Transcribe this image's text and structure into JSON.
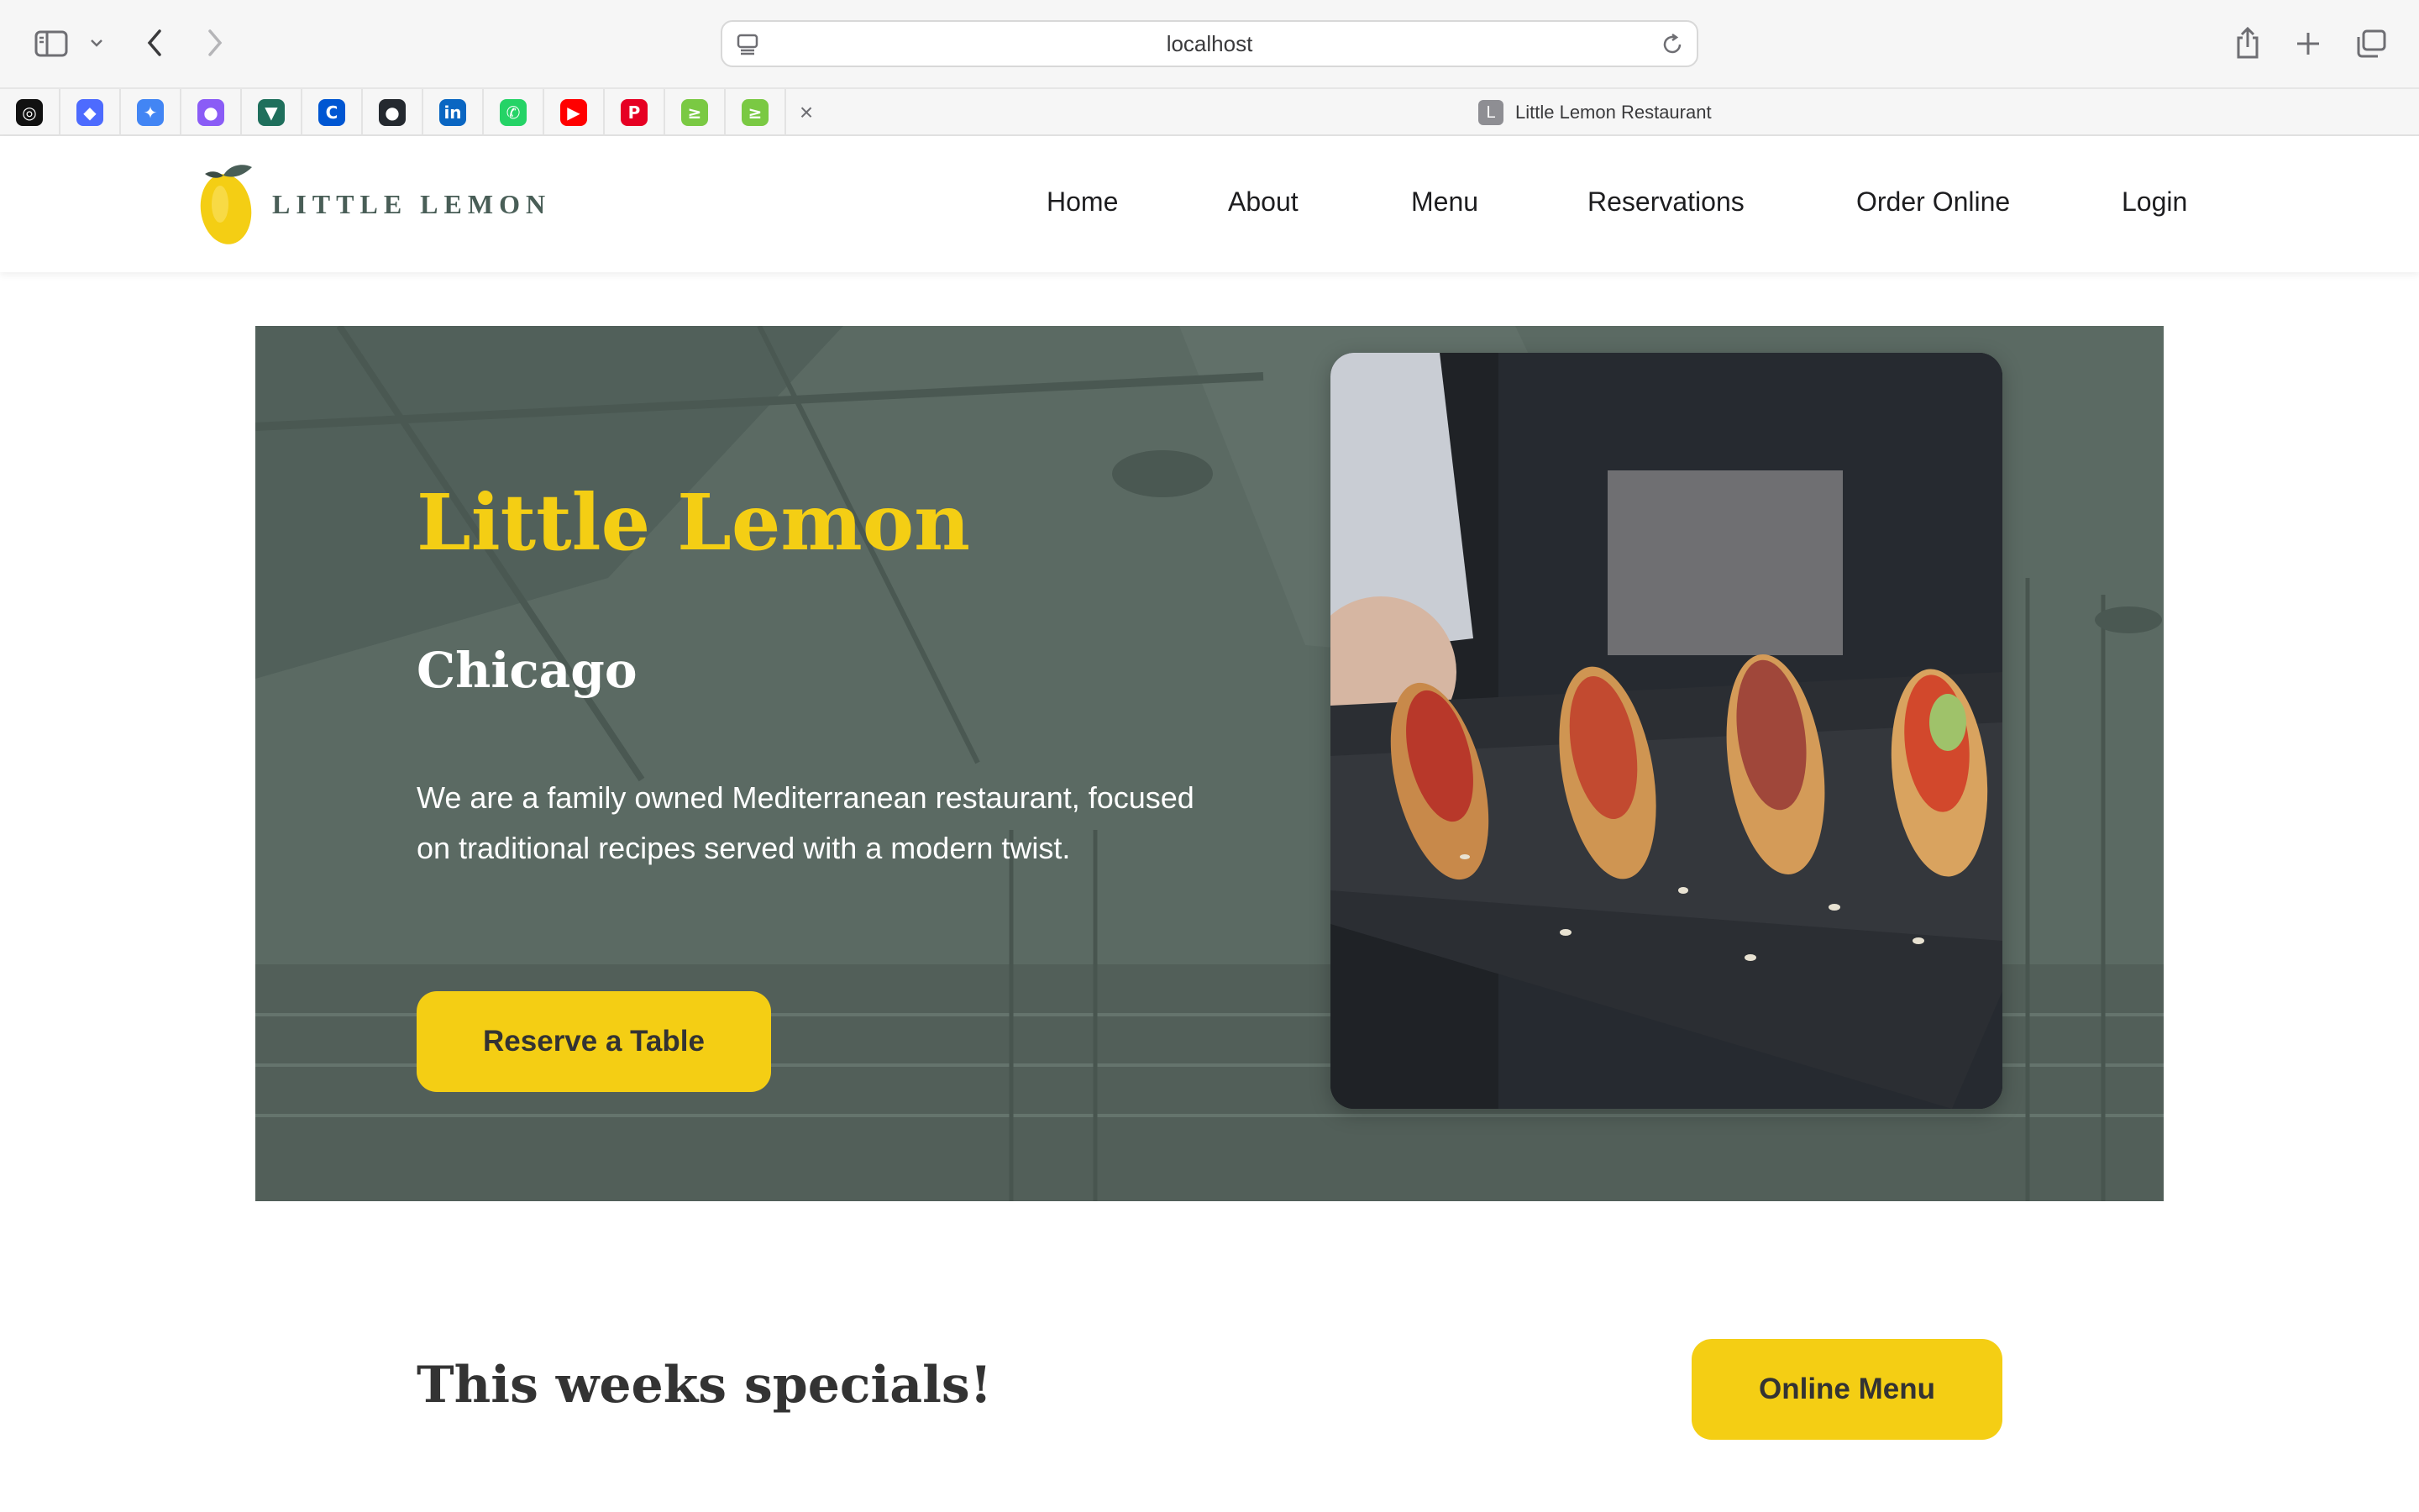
{
  "browser": {
    "url": "localhost",
    "active_tab_title": "Little Lemon Restaurant",
    "active_tab_favicon_letter": "L",
    "pinned_tabs": [
      {
        "icon": "openai-icon",
        "color": "#111111",
        "glyph": "◎"
      },
      {
        "icon": "deepseek-icon",
        "color": "#4d6bfe",
        "glyph": "◆"
      },
      {
        "icon": "gemini-icon",
        "color": "#4285f4",
        "glyph": "✦"
      },
      {
        "icon": "copilot-icon",
        "color": "#8a5cf6",
        "glyph": "●"
      },
      {
        "icon": "vue-icon",
        "color": "#1f6f5c",
        "glyph": "▼"
      },
      {
        "icon": "coursera-icon",
        "color": "#0056d2",
        "glyph": "C"
      },
      {
        "icon": "github-icon",
        "color": "#24292f",
        "glyph": "●"
      },
      {
        "icon": "linkedin-icon",
        "color": "#0a66c2",
        "glyph": "in"
      },
      {
        "icon": "whatsapp-icon",
        "color": "#25d366",
        "glyph": "✆"
      },
      {
        "icon": "youtube-icon",
        "color": "#ff0000",
        "glyph": "▶"
      },
      {
        "icon": "pinterest-icon",
        "color": "#e60023",
        "glyph": "P"
      },
      {
        "icon": "leetcode-icon",
        "color": "#7ac943",
        "glyph": "≥"
      },
      {
        "icon": "leetcode-icon",
        "color": "#7ac943",
        "glyph": "≥"
      }
    ],
    "close_glyph": "×"
  },
  "site": {
    "logo_text": "LITTLE LEMON",
    "nav": [
      "Home",
      "About",
      "Menu",
      "Reservations",
      "Order Online",
      "Login"
    ]
  },
  "hero": {
    "title": "Little Lemon",
    "city": "Chicago",
    "description": "We are a family owned Mediterranean restaurant, focused on traditional recipes served with a modern twist.",
    "cta": "Reserve a Table"
  },
  "specials": {
    "title": "This weeks specials!",
    "cta": "Online Menu"
  },
  "colors": {
    "primary_green": "#495e57",
    "primary_yellow": "#f4ce14",
    "dark_text": "#333333"
  }
}
